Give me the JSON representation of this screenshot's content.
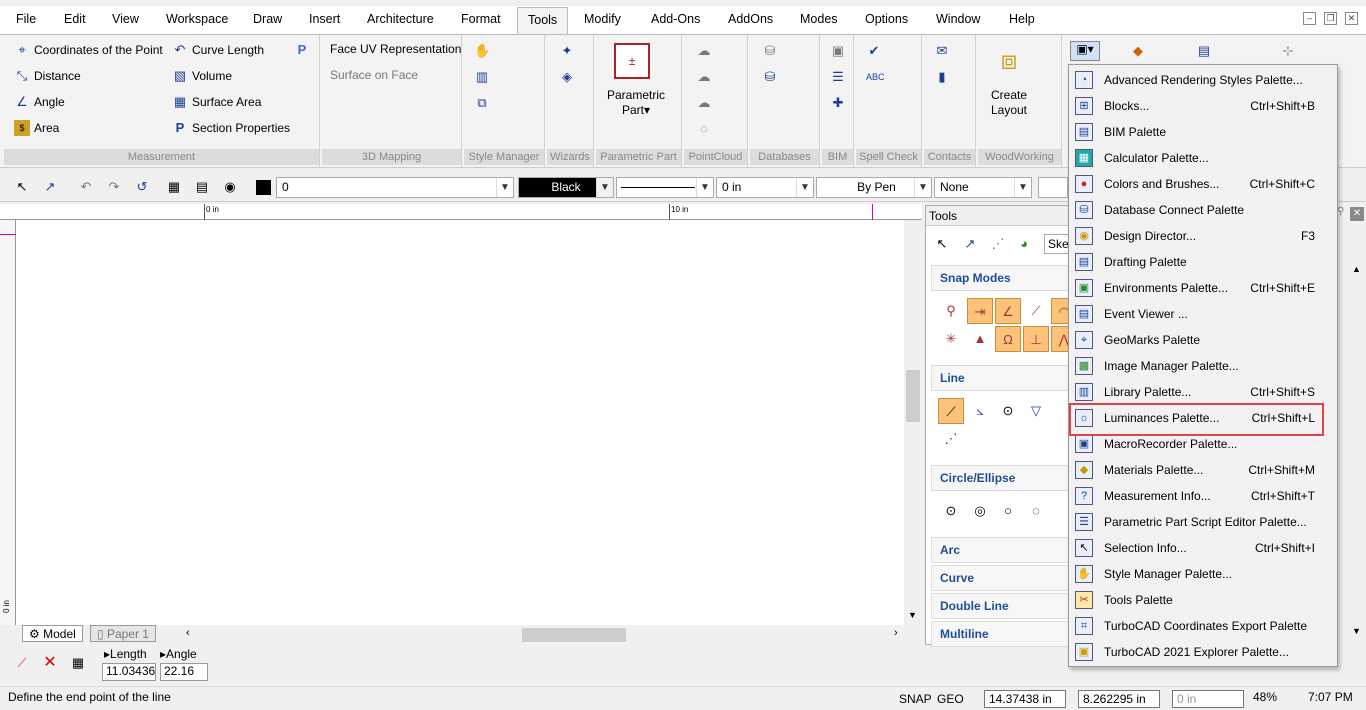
{
  "menubar": {
    "items": [
      "File",
      "Edit",
      "View",
      "Workspace",
      "Draw",
      "Insert",
      "Architecture",
      "Format",
      "Tools",
      "Modify",
      "Add-Ons",
      "AddOns",
      "Modes",
      "Options",
      "Window",
      "Help"
    ],
    "active": "Tools"
  },
  "ribbon": {
    "measurement": {
      "label": "Measurement",
      "coords": "Coordinates of the Point",
      "distance": "Distance",
      "angle": "Angle",
      "area": "Area",
      "curve_length": "Curve Length",
      "volume": "Volume",
      "surface_area": "Surface Area",
      "section_props": "Section Properties"
    },
    "mapping": {
      "label": "3D Mapping",
      "face_uv": "Face UV Representation",
      "surface_on_face": "Surface on Face"
    },
    "style_manager": {
      "label": "Style Manager"
    },
    "wizards": {
      "label": "Wizards"
    },
    "parametric": {
      "label": "Parametric Part",
      "btn1": "Parametric",
      "btn2": "Part▾"
    },
    "pointcloud": {
      "label": "PointCloud"
    },
    "databases": {
      "label": "Databases"
    },
    "bim": {
      "label": "BIM"
    },
    "spell": {
      "label": "Spell Check"
    },
    "contacts": {
      "label": "Contacts"
    },
    "woodworking": {
      "label": "WoodWorking",
      "btn1": "Create",
      "btn2": "Layout"
    }
  },
  "propbar": {
    "layer": "0",
    "color": "Black",
    "width": "0 in",
    "pen": "By Pen",
    "none": "None"
  },
  "ruler": {
    "t0": "0 in",
    "t10": "10 in",
    "v0": "0 in"
  },
  "tabs": {
    "model": "Model",
    "paper": "Paper 1"
  },
  "inspector": {
    "length_label": "Length",
    "angle_label": "Angle",
    "length": "11.03436",
    "angle": "22.16"
  },
  "status": {
    "prompt": "Define the end point of the line",
    "snap": "SNAP",
    "geo": "GEO",
    "x": "14.37438 in",
    "y": "8.262295 in",
    "z": "0 in",
    "zoom": "48%",
    "time": "7:07 PM"
  },
  "palette": {
    "title": "Tools",
    "search": "Sket",
    "sections": {
      "snap": "Snap Modes",
      "line": "Line",
      "circle": "Circle/Ellipse",
      "arc": "Arc",
      "curve": "Curve",
      "double": "Double Line",
      "multi": "Multiline"
    }
  },
  "dropdown": {
    "items": [
      {
        "label": "Advanced Rendering Styles Palette...",
        "shortcut": ""
      },
      {
        "label": "Blocks...",
        "shortcut": "Ctrl+Shift+B"
      },
      {
        "label": "BIM Palette",
        "shortcut": ""
      },
      {
        "label": "Calculator Palette...",
        "shortcut": ""
      },
      {
        "label": "Colors and Brushes...",
        "shortcut": "Ctrl+Shift+C"
      },
      {
        "label": "Database Connect Palette",
        "shortcut": ""
      },
      {
        "label": "Design Director...",
        "shortcut": "F3"
      },
      {
        "label": "Drafting Palette",
        "shortcut": ""
      },
      {
        "label": "Environments Palette...",
        "shortcut": "Ctrl+Shift+E"
      },
      {
        "label": "Event Viewer ...",
        "shortcut": ""
      },
      {
        "label": "GeoMarks Palette",
        "shortcut": ""
      },
      {
        "label": "Image Manager Palette...",
        "shortcut": ""
      },
      {
        "label": "Library Palette...",
        "shortcut": "Ctrl+Shift+S"
      },
      {
        "label": "Luminances Palette...",
        "shortcut": "Ctrl+Shift+L"
      },
      {
        "label": "MacroRecorder Palette...",
        "shortcut": ""
      },
      {
        "label": "Materials Palette...",
        "shortcut": "Ctrl+Shift+M"
      },
      {
        "label": "Measurement Info...",
        "shortcut": "Ctrl+Shift+T"
      },
      {
        "label": "Parametric Part Script Editor Palette...",
        "shortcut": ""
      },
      {
        "label": "Selection Info...",
        "shortcut": "Ctrl+Shift+I"
      },
      {
        "label": "Style Manager Palette...",
        "shortcut": ""
      },
      {
        "label": "Tools Palette",
        "shortcut": ""
      },
      {
        "label": "TurboCAD Coordinates Export Palette",
        "shortcut": ""
      },
      {
        "label": "TurboCAD 2021 Explorer Palette...",
        "shortcut": ""
      }
    ]
  },
  "colors": {
    "highlight": "#e0454a",
    "snap_on": "#fbc27a",
    "section_text": "#1f4e96"
  }
}
